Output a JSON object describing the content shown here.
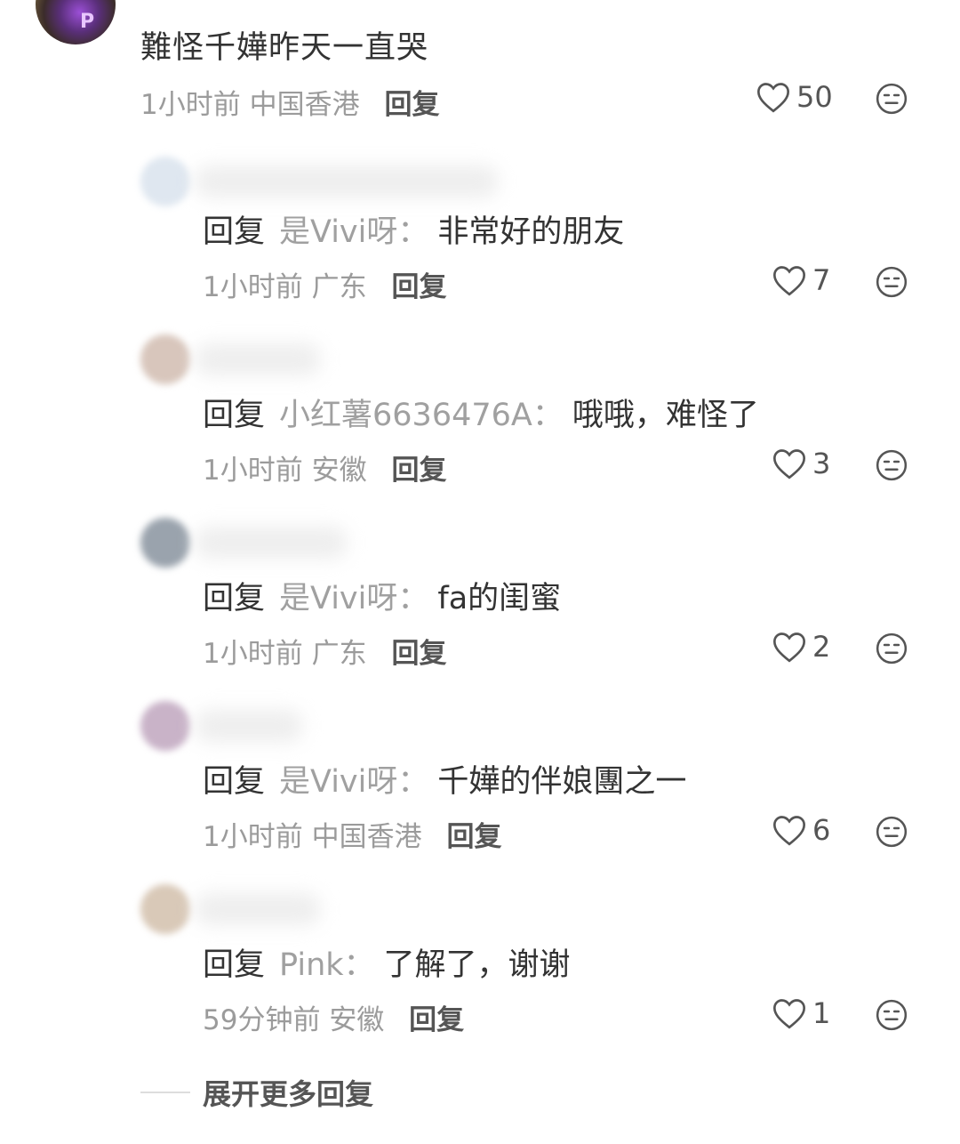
{
  "main_comment": {
    "text": "難怪千嬅昨天一直哭",
    "time": "1小时前",
    "location": "中国香港",
    "reply_label": "回复",
    "likes": "50"
  },
  "replies": [
    {
      "prefix": "回复",
      "to_user": "是Vivi呀",
      "colon": "：",
      "text": "非常好的朋友",
      "time": "1小时前",
      "location": "广东",
      "reply_label": "回复",
      "likes": "7"
    },
    {
      "prefix": "回复",
      "to_user": "小红薯6636476A",
      "colon": "：",
      "text": "哦哦，难怪了",
      "time": "1小时前",
      "location": "安徽",
      "reply_label": "回复",
      "likes": "3"
    },
    {
      "prefix": "回复",
      "to_user": "是Vivi呀",
      "colon": "：",
      "text": "fa的闺蜜",
      "time": "1小时前",
      "location": "广东",
      "reply_label": "回复",
      "likes": "2"
    },
    {
      "prefix": "回复",
      "to_user": "是Vivi呀",
      "colon": "：",
      "text": "千嬅的伴娘團之一",
      "time": "1小时前",
      "location": "中国香港",
      "reply_label": "回复",
      "likes": "6"
    },
    {
      "prefix": "回复",
      "to_user": "Pink",
      "colon": "：",
      "text": "了解了，谢谢",
      "time": "59分钟前",
      "location": "安徽",
      "reply_label": "回复",
      "likes": "1"
    }
  ],
  "expand_more": "展开更多回复",
  "icons": {
    "like": "heart-outline-icon",
    "react": "neutral-face-icon"
  }
}
